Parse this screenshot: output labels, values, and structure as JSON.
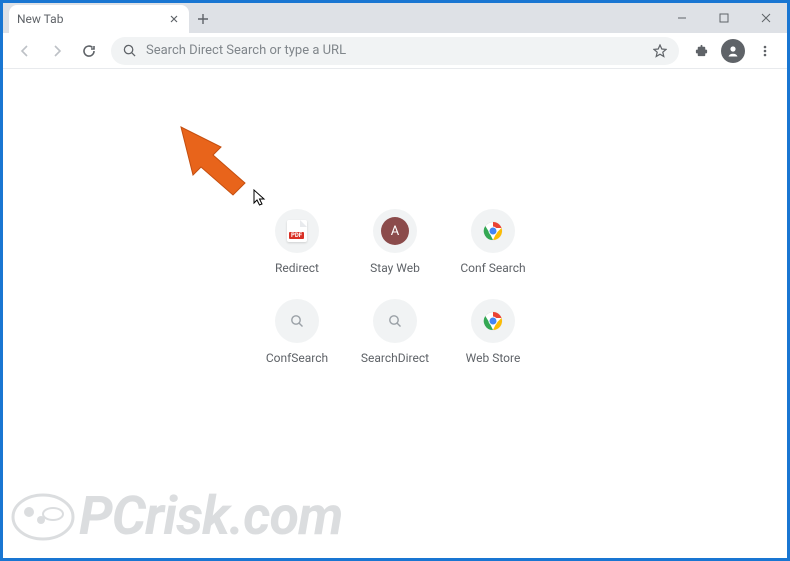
{
  "tab": {
    "title": "New Tab"
  },
  "omnibox": {
    "placeholder": "Search Direct Search or type a URL"
  },
  "shortcuts": [
    {
      "label": "Redirect",
      "icon": "pdf"
    },
    {
      "label": "Stay Web",
      "icon": "letter",
      "letter": "A"
    },
    {
      "label": "Conf Search",
      "icon": "chrome"
    },
    {
      "label": "ConfSearch",
      "icon": "search"
    },
    {
      "label": "SearchDirect",
      "icon": "search"
    },
    {
      "label": "Web Store",
      "icon": "chrome"
    }
  ],
  "watermark": {
    "text": "PCrisk.com"
  }
}
